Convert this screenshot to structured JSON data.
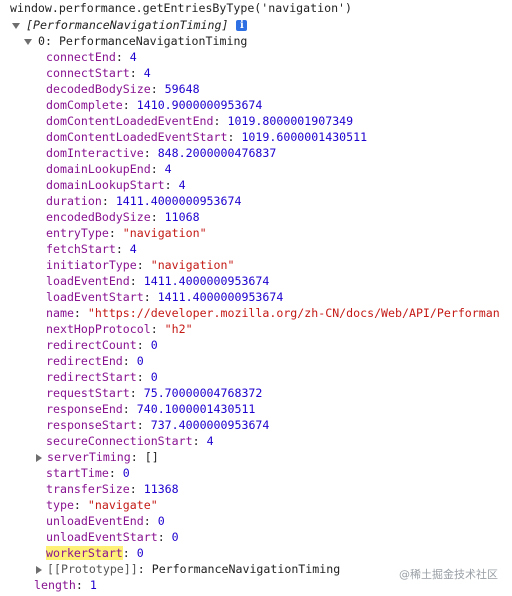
{
  "console": {
    "command": "window.performance.getEntriesByType('navigation')",
    "array_summary": "[PerformanceNavigationTiming]",
    "item_label": "0: PerformanceNavigationTiming",
    "info_glyph": "i",
    "properties": [
      {
        "key": "connectEnd",
        "value": "4",
        "type": "num"
      },
      {
        "key": "connectStart",
        "value": "4",
        "type": "num"
      },
      {
        "key": "decodedBodySize",
        "value": "59648",
        "type": "num"
      },
      {
        "key": "domComplete",
        "value": "1410.9000000953674",
        "type": "num"
      },
      {
        "key": "domContentLoadedEventEnd",
        "value": "1019.8000001907349",
        "type": "num"
      },
      {
        "key": "domContentLoadedEventStart",
        "value": "1019.6000001430511",
        "type": "num"
      },
      {
        "key": "domInteractive",
        "value": "848.2000000476837",
        "type": "num"
      },
      {
        "key": "domainLookupEnd",
        "value": "4",
        "type": "num"
      },
      {
        "key": "domainLookupStart",
        "value": "4",
        "type": "num"
      },
      {
        "key": "duration",
        "value": "1411.4000000953674",
        "type": "num"
      },
      {
        "key": "encodedBodySize",
        "value": "11068",
        "type": "num"
      },
      {
        "key": "entryType",
        "value": "\"navigation\"",
        "type": "str"
      },
      {
        "key": "fetchStart",
        "value": "4",
        "type": "num"
      },
      {
        "key": "initiatorType",
        "value": "\"navigation\"",
        "type": "str"
      },
      {
        "key": "loadEventEnd",
        "value": "1411.4000000953674",
        "type": "num"
      },
      {
        "key": "loadEventStart",
        "value": "1411.4000000953674",
        "type": "num"
      },
      {
        "key": "name",
        "value": "\"https://developer.mozilla.org/zh-CN/docs/Web/API/Performan",
        "type": "str"
      },
      {
        "key": "nextHopProtocol",
        "value": "\"h2\"",
        "type": "str"
      },
      {
        "key": "redirectCount",
        "value": "0",
        "type": "num"
      },
      {
        "key": "redirectEnd",
        "value": "0",
        "type": "num"
      },
      {
        "key": "redirectStart",
        "value": "0",
        "type": "num"
      },
      {
        "key": "requestStart",
        "value": "75.70000004768372",
        "type": "num"
      },
      {
        "key": "responseEnd",
        "value": "740.1000001430511",
        "type": "num"
      },
      {
        "key": "responseStart",
        "value": "737.4000000953674",
        "type": "num"
      },
      {
        "key": "secureConnectionStart",
        "value": "4",
        "type": "num"
      },
      {
        "key": "serverTiming",
        "value": "[]",
        "type": "plain",
        "expandable": true
      },
      {
        "key": "startTime",
        "value": "0",
        "type": "num"
      },
      {
        "key": "transferSize",
        "value": "11368",
        "type": "num"
      },
      {
        "key": "type",
        "value": "\"navigate\"",
        "type": "str"
      },
      {
        "key": "unloadEventEnd",
        "value": "0",
        "type": "num"
      },
      {
        "key": "unloadEventStart",
        "value": "0",
        "type": "num"
      },
      {
        "key": "workerStart",
        "value": "0",
        "type": "num",
        "highlighted": true
      }
    ],
    "prototype_key": "[[Prototype]]",
    "prototype_value": "PerformanceNavigationTiming",
    "length_key": "length",
    "length_value": "1"
  },
  "watermark": "@稀土掘金技术社区",
  "colors": {
    "key": "#881391",
    "number": "#1c00cf",
    "string": "#c41a16",
    "highlight": "#fff176",
    "info_icon": "#2f6fe4"
  }
}
